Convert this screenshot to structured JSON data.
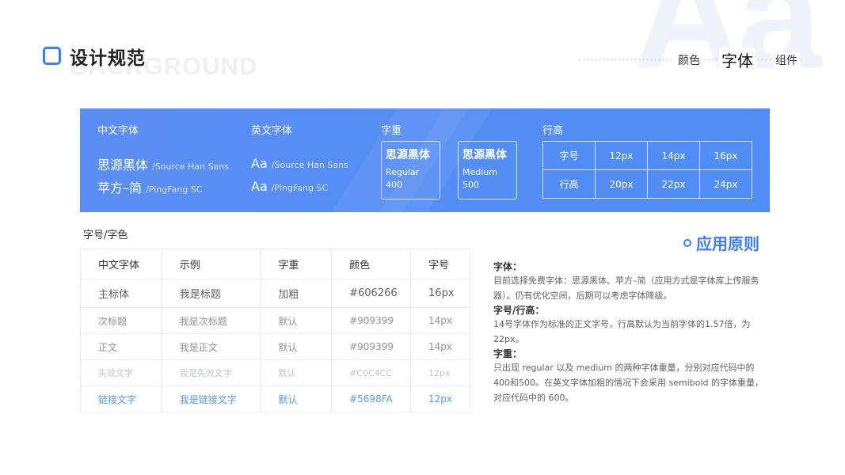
{
  "watermark": {
    "letters": "Aa",
    "word": "BACKGROUND"
  },
  "header": {
    "title": "设计规范",
    "nav": {
      "colors": "颜色",
      "fonts": "字体",
      "components": "组件"
    }
  },
  "banner": {
    "cn_font": {
      "heading": "中文字体",
      "fonts": [
        {
          "name": "思源黑体",
          "en": "/Source Han Sans"
        },
        {
          "name": "苹方–简",
          "en": "/PingFang SC"
        }
      ]
    },
    "en_font": {
      "heading": "英文字体",
      "fonts": [
        {
          "sample": "Aa",
          "en": "/Source Han Sans"
        },
        {
          "sample": "Aa",
          "en": "/PingFang SC"
        }
      ]
    },
    "weight": {
      "heading": "字重",
      "items": [
        {
          "name": "思源黑体",
          "label": "Regular",
          "value": "400"
        },
        {
          "name": "思源黑体",
          "label": "Medium",
          "value": "500"
        }
      ]
    },
    "line_height": {
      "heading": "行高",
      "rows": [
        {
          "label": "字号",
          "values": [
            "12px",
            "14px",
            "16px"
          ]
        },
        {
          "label": "行高",
          "values": [
            "20px",
            "22px",
            "24px"
          ]
        }
      ]
    }
  },
  "spec_table": {
    "section_label": "字号/字色",
    "headers": [
      "中文字体",
      "示例",
      "字重",
      "颜色",
      "字号"
    ],
    "rows": [
      [
        "主标体",
        "我是标题",
        "加粗",
        "#606266",
        "16px"
      ],
      [
        "次标题",
        "我是次标题",
        "默认",
        "#909399",
        "14px"
      ],
      [
        "正文",
        "我是正文",
        "默认",
        "#909399",
        "14px"
      ],
      [
        "失效文字",
        "我是失效文字",
        "默认",
        "#C0C4CC",
        "12px"
      ],
      [
        "链接文字",
        "我是链接文字",
        "默认",
        "#5698FA",
        "12px"
      ]
    ]
  },
  "principles": {
    "title": "应用原则",
    "sections": [
      {
        "head": "字体：",
        "text": "目前选择免费字体：思源黑体、苹方–简（应用方式是字体库上传服务器）。仍有优化空间，后期可以考虑字体降级。"
      },
      {
        "head": "字号/行高：",
        "text": "14号字体作为标准的正文字号，行高默认为当前字体的1.57倍，为22px。"
      },
      {
        "head": "字重：",
        "text": "只出现 regular 以及 medium 的两种字体重量，分别对应代码中的400和500。在英文字体加粗的情况下会采用 semibold 的字体重量，对应代码中的 600。"
      }
    ]
  },
  "colors": {
    "accent": "#3d7bf7",
    "banner": "#5b8ef5",
    "main_text": "#606266",
    "secondary_text": "#909399",
    "disabled_text": "#C0C4CC",
    "link_text": "#5698FA"
  }
}
